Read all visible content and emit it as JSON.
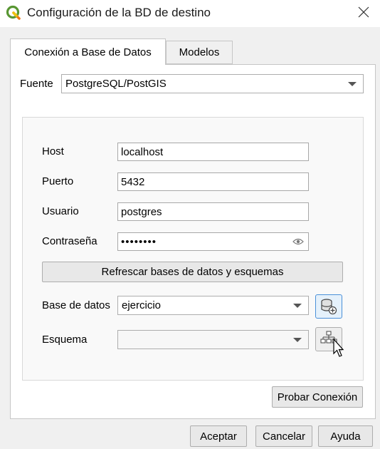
{
  "window": {
    "title": "Configuración de la BD de destino"
  },
  "tabs": [
    {
      "label": "Conexión a Base de Datos"
    },
    {
      "label": "Modelos"
    }
  ],
  "source": {
    "label": "Fuente",
    "value": "PostgreSQL/PostGIS"
  },
  "form": {
    "host": {
      "label": "Host",
      "value": "localhost"
    },
    "port": {
      "label": "Puerto",
      "value": "5432"
    },
    "user": {
      "label": "Usuario",
      "value": "postgres"
    },
    "password": {
      "label": "Contraseña",
      "value": "••••••••"
    },
    "refresh_label": "Refrescar bases de datos y esquemas",
    "database": {
      "label": "Base de datos",
      "value": "ejercicio"
    },
    "schema": {
      "label": "Esquema",
      "value": ""
    }
  },
  "test_connection_label": "Probar Conexión",
  "footer": {
    "accept_label": "Aceptar",
    "cancel_label": "Cancelar",
    "help_label": "Ayuda"
  },
  "icons": {
    "app": "qgis-logo-icon",
    "close": "close-icon",
    "eye": "eye-icon",
    "create_db": "database-add-icon",
    "create_schema": "schema-tree-icon",
    "cursor": "mouse-pointer-icon"
  },
  "colors": {
    "accent": "#4a90d9",
    "qgis_green": "#589632"
  }
}
